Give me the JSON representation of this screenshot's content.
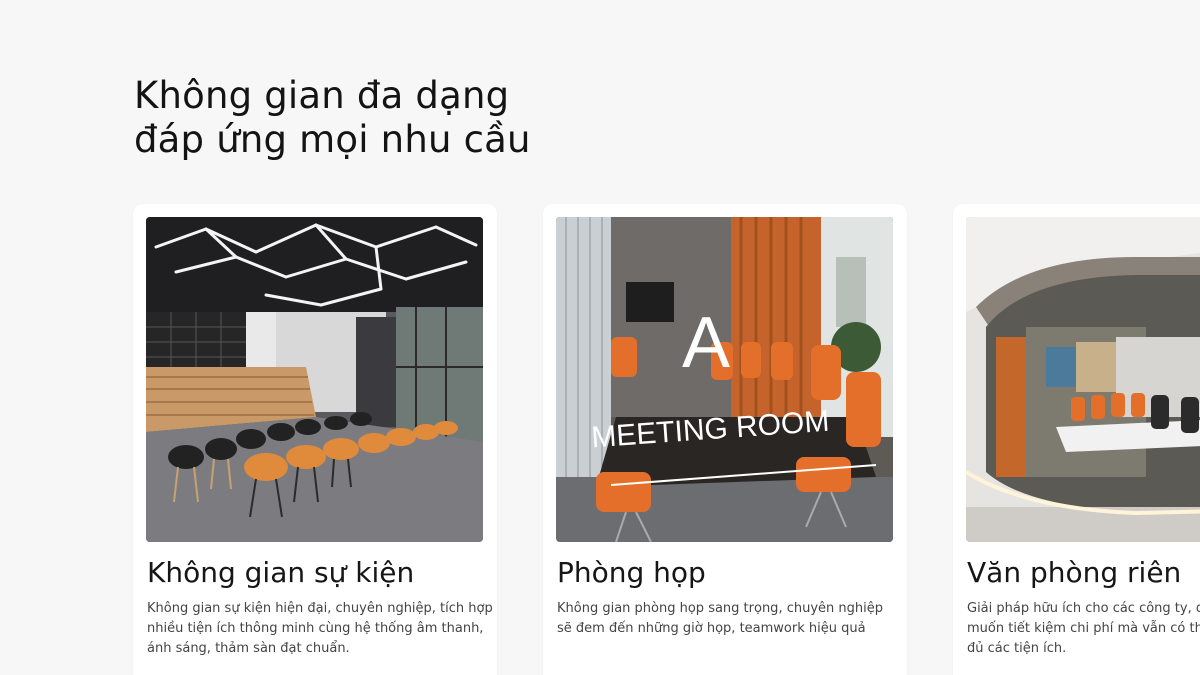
{
  "headline": {
    "line1": "Không gian đa dạng",
    "line2": "đáp ứng mọi nhu cầu"
  },
  "cards": [
    {
      "title": "Không gian sự kiện",
      "desc_lines": [
        "Không gian sự kiện hiện đại, chuyên nghiệp, tích hợp",
        "nhiều tiện ích thông minh cùng hệ thống âm thanh,",
        "ánh sáng, thảm sàn đạt chuẩn."
      ]
    },
    {
      "title": "Phòng họp",
      "photo_sign": "A",
      "photo_sign_text": "MEETING ROOM",
      "desc_lines": [
        "Không gian phòng họp sang trọng, chuyên nghiệp",
        "sẽ đem đến những giờ họp, teamwork hiệu quả"
      ]
    },
    {
      "title": "Văn phòng riên",
      "desc_lines": [
        "Giải pháp hữu ích cho các công ty, d",
        "muốn tiết kiệm chi phí mà vẫn có thể",
        "đủ các tiện ích."
      ]
    }
  ],
  "colors": {
    "background": "#f7f7f7",
    "card": "#ffffff",
    "accent_orange": "#e07a34",
    "title_text": "#161616",
    "body_text": "#444444"
  }
}
